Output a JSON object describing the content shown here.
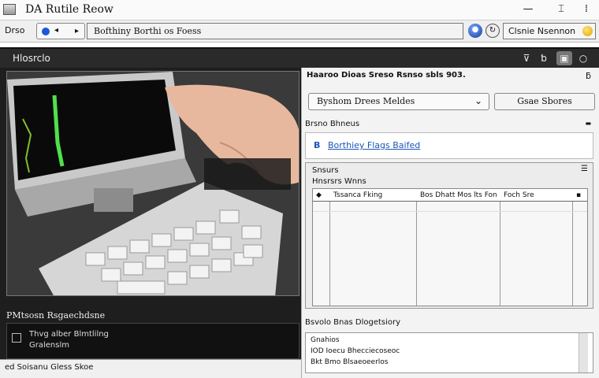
{
  "window": {
    "title": "DA Rutile Reow",
    "minimize": "—",
    "maximize": "⌶",
    "close": "⁞"
  },
  "address_bar": {
    "label": "Drso",
    "nav_text": "●",
    "url": "Bofthiny Borthi os Foess",
    "search_text": "Clsnie Nsennon"
  },
  "panel_header": {
    "title": "Hlosrclo"
  },
  "media": {
    "caption": "PMtsosn Rsgaechdsne",
    "message_line1": "Thvg alber Blmtlilng",
    "message_line2": "Gralenslm",
    "status": "ed Soisanu Gless Skoe"
  },
  "right_panel": {
    "header": "Haaroo Dioas Sreso Rsnso sbls 903.",
    "dropdown_value": "Byshom Drees Meldes",
    "save_button": "Gsae Sbores",
    "section_label": "Brsno Bhneus",
    "link_prefix": "B",
    "link_text": "Borthiey Flags Baifed",
    "table_title": "Snsurs",
    "table_subtitle": "Hnsrsrs Wnns",
    "columns": [
      "Tssanca Fking",
      "Bos Dhatt Mos lts Fon",
      "Foch Sre"
    ],
    "output_label": "Bsvolo Bnas Dlogetsiory",
    "output_title": "Gnahios",
    "output_line1": "IOD  Ioecu Bhecciecoseoc",
    "output_line2": "Bkt  Bmo Blsaeoeerlos"
  }
}
